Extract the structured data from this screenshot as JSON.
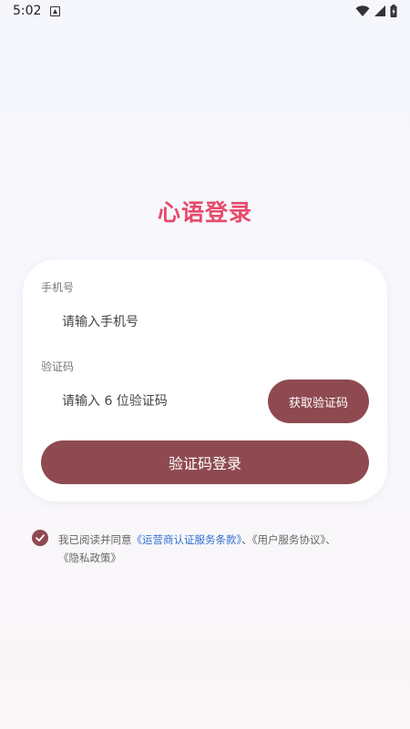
{
  "status_bar": {
    "time": "5:02",
    "icons": [
      "notification-icon",
      "wifi-icon",
      "signal-icon",
      "battery-icon"
    ]
  },
  "page": {
    "title": "心语登录"
  },
  "form": {
    "phone_label": "手机号",
    "phone_placeholder": "请输入手机号",
    "phone_value": "",
    "code_label": "验证码",
    "code_placeholder": "请输入 6 位验证码",
    "code_value": "",
    "get_code_label": "获取验证码",
    "login_label": "验证码登录"
  },
  "agreement": {
    "checked": true,
    "prefix": "我已阅读并同意",
    "link_operator": "《运营商认证服务条款》",
    "sep1": "、",
    "link_user": "《用户服务协议》",
    "sep2": "、",
    "link_privacy": "《隐私政策》"
  },
  "colors": {
    "title": "#e64a6b",
    "button": "#8f4a51",
    "link": "#2f6fcf",
    "background": "#f6f7fc"
  }
}
